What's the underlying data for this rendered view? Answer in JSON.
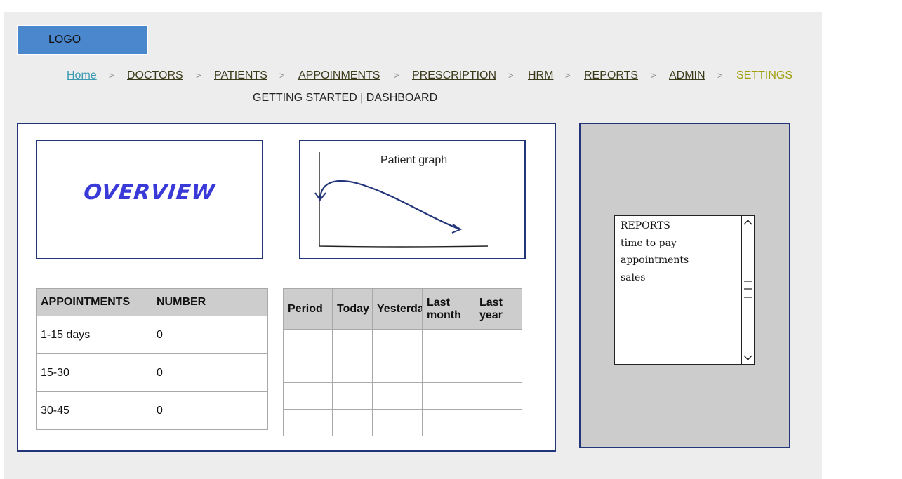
{
  "header": {
    "logo": "LOGO",
    "breadcrumb": [
      {
        "label": "Home"
      },
      {
        "label": "DOCTORS"
      },
      {
        "label": "PATIENTS"
      },
      {
        "label": "APPOINMENTS"
      },
      {
        "label": "PRESCRIPTION"
      },
      {
        "label": "HRM"
      },
      {
        "label": "REPORTS"
      },
      {
        "label": "ADMIN"
      },
      {
        "label": "SETTINGS"
      }
    ],
    "separator": ">",
    "subtitle": "GETTING STARTED | DASHBOARD"
  },
  "overview": {
    "title": "OVERVIEW"
  },
  "graph": {
    "title": "Patient graph"
  },
  "appointments_table": {
    "headers": [
      "APPOINTMENTS",
      "NUMBER"
    ],
    "rows": [
      [
        "1-15 days",
        "0"
      ],
      [
        "15-30",
        "0"
      ],
      [
        "30-45",
        "0"
      ]
    ]
  },
  "period_table": {
    "headers": [
      "Period",
      "Today",
      "Yesterday",
      "Last month",
      "Last year"
    ],
    "rows": [
      [
        "",
        "",
        "",
        "",
        ""
      ],
      [
        "",
        "",
        "",
        "",
        ""
      ],
      [
        "",
        "",
        "",
        "",
        ""
      ],
      [
        "",
        "",
        "",
        "",
        ""
      ]
    ]
  },
  "reports_list": {
    "items": [
      "REPORTS",
      "time to pay",
      "appointments",
      "sales"
    ]
  },
  "colors": {
    "accent_border": "#23357a",
    "logo_bg": "#4a87cc",
    "overview_text": "#3a3ad8",
    "home_link": "#3c9bb1",
    "settings_link": "#9e9e0a"
  }
}
